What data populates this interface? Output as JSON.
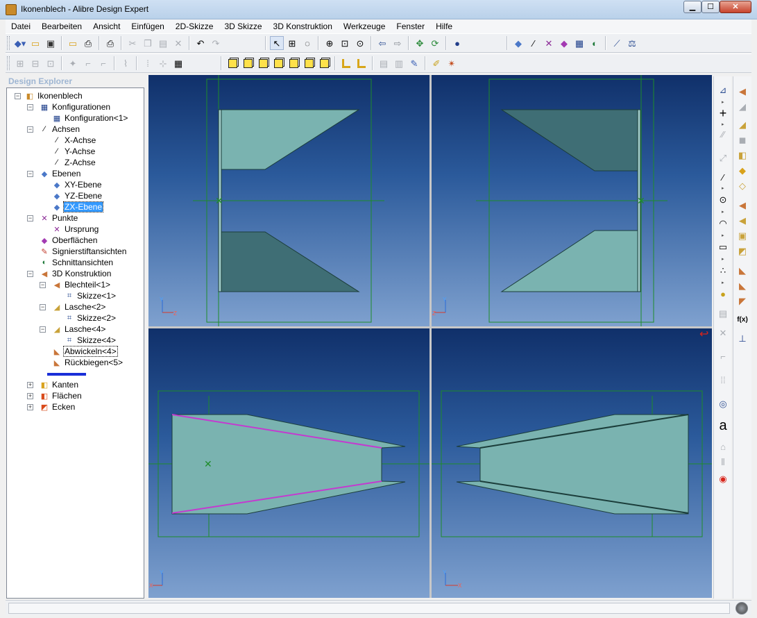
{
  "window": {
    "title": "Ikonenblech - Alibre Design Expert",
    "minimize_icon": "minimize-icon",
    "maximize_icon": "maximize-icon",
    "close_icon": "close-icon"
  },
  "menu": [
    "Datei",
    "Bearbeiten",
    "Ansicht",
    "Einfügen",
    "2D-Skizze",
    "3D Skizze",
    "3D Konstruktion",
    "Werkzeuge",
    "Fenster",
    "Hilfe"
  ],
  "toolbar1": {
    "icons": [
      "new-icon",
      "open-icon",
      "save-icon",
      "open-folder-icon",
      "print-setup-icon",
      "print-icon",
      "cut-icon",
      "copy-icon",
      "paste-icon",
      "delete-icon",
      "undo-icon",
      "redo-icon",
      "select-icon",
      "select-box-icon",
      "lasso-icon",
      "zoom-in-icon",
      "zoom-window-icon",
      "zoom-fit-icon",
      "previous-view-icon",
      "next-view-icon",
      "pan-icon",
      "rotate-icon",
      "render-icon",
      "plane-icon",
      "axis-icon",
      "point-icon",
      "surface-icon",
      "table-icon",
      "section-icon",
      "measure-icon",
      "balance-icon"
    ]
  },
  "toolbar2": {
    "icons": [
      "constraints-icon",
      "relations-icon",
      "dimensions-icon",
      "hide-icon",
      "sketch-icon",
      "sketch-edit-icon",
      "curve-icon",
      "grid-icon",
      "mesh-icon",
      "table-grid-icon",
      "view-front-icon",
      "view-back-icon",
      "view-top-icon",
      "view-bottom-icon",
      "view-left-icon",
      "view-right-icon",
      "view-iso-icon",
      "flange-icon",
      "bend-icon",
      "hatch-icon",
      "hatch-alt-icon",
      "paint-icon",
      "design-icon",
      "sparkle-icon"
    ]
  },
  "explorer": {
    "title": "Design Explorer",
    "nodes": [
      {
        "label": "Ikonenblech",
        "icon": "part-icon",
        "expander": "−"
      },
      {
        "label": "Konfigurationen",
        "icon": "configurations-icon",
        "expander": "−"
      },
      {
        "label": "Konfiguration<1>",
        "icon": "configuration-icon"
      },
      {
        "label": "Achsen",
        "icon": "axes-icon",
        "expander": "−"
      },
      {
        "label": "X-Achse",
        "icon": "axis-icon"
      },
      {
        "label": "Y-Achse",
        "icon": "axis-icon"
      },
      {
        "label": "Z-Achse",
        "icon": "axis-icon"
      },
      {
        "label": "Ebenen",
        "icon": "planes-icon",
        "expander": "−"
      },
      {
        "label": "XY-Ebene",
        "icon": "plane-icon"
      },
      {
        "label": "YZ-Ebene",
        "icon": "plane-icon"
      },
      {
        "label": "ZX-Ebene",
        "icon": "plane-icon",
        "selected": true
      },
      {
        "label": "Punkte",
        "icon": "points-icon",
        "expander": "−"
      },
      {
        "label": "Ursprung",
        "icon": "origin-icon"
      },
      {
        "label": "Oberflächen",
        "icon": "surfaces-icon"
      },
      {
        "label": "Signierstiftansichten",
        "icon": "redline-views-icon"
      },
      {
        "label": "Schnittansichten",
        "icon": "section-views-icon"
      },
      {
        "label": "3D Konstruktion",
        "icon": "design-icon",
        "expander": "−"
      },
      {
        "label": "Blechteil<1>",
        "icon": "sheetmetal-icon",
        "expander": "−"
      },
      {
        "label": "Skizze<1>",
        "icon": "sketch-icon"
      },
      {
        "label": "Lasche<2>",
        "icon": "flange-icon",
        "expander": "−"
      },
      {
        "label": "Skizze<2>",
        "icon": "sketch-icon"
      },
      {
        "label": "Lasche<4>",
        "icon": "flange-icon",
        "expander": "−"
      },
      {
        "label": "Skizze<4>",
        "icon": "sketch-icon"
      },
      {
        "label": "Abwickeln<4>",
        "icon": "unfold-icon"
      },
      {
        "label": "Rückbiegen<5>",
        "icon": "refold-icon"
      },
      {
        "label": "Kanten",
        "icon": "edges-icon",
        "expander": "+"
      },
      {
        "label": "Flächen",
        "icon": "faces-icon",
        "expander": "+"
      },
      {
        "label": "Ecken",
        "icon": "corners-icon",
        "expander": "+"
      }
    ]
  },
  "viewports": {
    "top_left": {
      "name": "front-view",
      "triad": [
        "Y",
        "Z"
      ]
    },
    "top_right": {
      "name": "back-view",
      "triad": [
        "Y",
        "Z"
      ]
    },
    "bottom_left": {
      "name": "top-view",
      "triad": [
        "Y",
        "X"
      ]
    },
    "bottom_right": {
      "name": "bottom-view",
      "triad": [
        "Y",
        "X"
      ]
    }
  },
  "sketch_palette": {
    "icons": [
      "sketch-activate-icon",
      "crosshair-icon",
      "construction-line-icon",
      "dimension-icon",
      "line-icon",
      "circle-icon",
      "arc-icon",
      "rectangle-icon",
      "ellipse-icon",
      "point-icon",
      "trim-icon",
      "delete-icon",
      "fillet-icon",
      "pattern-icon",
      "circle-pattern-icon",
      "text-icon",
      "project-icon",
      "mirror-icon",
      "paint-icon"
    ],
    "text_glyph": "a",
    "function_label": "f(x)"
  },
  "feature_palette": {
    "icons": [
      "sheetmetal-icon",
      "bend-icon",
      "flange-icon",
      "tab-icon",
      "box-icon",
      "cut-icon",
      "emboss-icon",
      "hem-icon",
      "jog-icon",
      "relief-icon",
      "corner-icon",
      "unfold-icon",
      "refold-icon",
      "function-icon",
      "dimension-icon"
    ]
  },
  "colors": {
    "viewport_top": "#10306a",
    "viewport_bottom": "#7fa1cf",
    "part_face": "#7ab3b0",
    "part_edge": "#1b3d3a",
    "box_line": "#1e8c2a",
    "highlight_edge": "#c43ad0",
    "selection": "#3399ff"
  },
  "statusbar": {
    "text": ""
  }
}
